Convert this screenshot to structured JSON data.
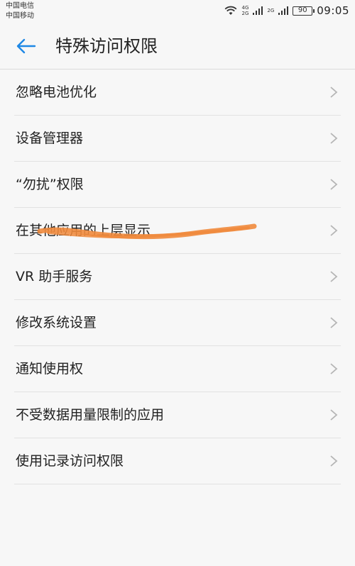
{
  "status_bar": {
    "carrier1": "中国电信",
    "carrier2": "中国移动",
    "net1_top": "4G",
    "net1_bottom": "2G",
    "net2_top": "2G",
    "battery": "90",
    "time": "09:05"
  },
  "header": {
    "title": "特殊访问权限"
  },
  "items": [
    {
      "label": "忽略电池优化"
    },
    {
      "label": "设备管理器"
    },
    {
      "label": "“勿扰”权限"
    },
    {
      "label": "在其他应用的上层显示"
    },
    {
      "label": "VR 助手服务"
    },
    {
      "label": "修改系统设置"
    },
    {
      "label": "通知使用权"
    },
    {
      "label": "不受数据用量限制的应用"
    },
    {
      "label": "使用记录访问权限"
    }
  ],
  "colors": {
    "accent": "#1e88e5",
    "annotation": "#f08a3c",
    "chevron": "#b5b5b5"
  }
}
